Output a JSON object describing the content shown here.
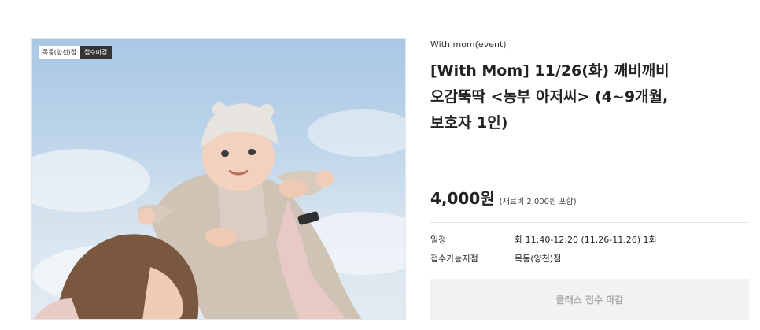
{
  "product": {
    "badges": {
      "branch": "목동(양천)점",
      "status": "접수마감"
    },
    "image_alt": "엄마가 아기를 하늘 위로 들어올리는 사진",
    "category": "With mom(event)",
    "title_lines": [
      "[With Mom] 11/26(화) 깨비깨비",
      "오감뚝딱 <농부 아저씨> (4~9개월,",
      "보호자 1인)"
    ],
    "price": "4,000원",
    "price_note": "(재료비 2,000원 포함)",
    "details": [
      {
        "label": "일정",
        "value": "화 11:40-12:20 (11.26-11.26) 1회"
      },
      {
        "label": "접수가능지점",
        "value": "목동(양천)점"
      }
    ],
    "cta_label": "클래스 접수 마감"
  }
}
